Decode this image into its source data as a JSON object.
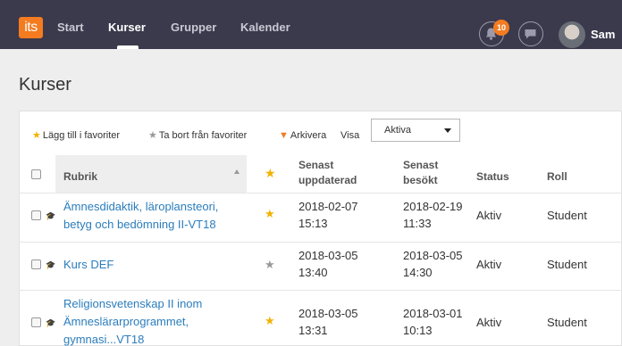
{
  "nav": {
    "logo": "its",
    "items": [
      {
        "label": "Start"
      },
      {
        "label": "Kurser"
      },
      {
        "label": "Grupper"
      },
      {
        "label": "Kalender"
      }
    ],
    "notifications_count": "10",
    "user_name": "Sam"
  },
  "page": {
    "title": "Kurser"
  },
  "toolbar": {
    "add_favorite": "Lägg till i favoriter",
    "remove_favorite": "Ta bort från favoriter",
    "archive": "Arkivera",
    "show_label": "Visa",
    "filter_value": "Aktiva"
  },
  "table": {
    "headers": {
      "title": "Rubrik",
      "updated_1": "Senast",
      "updated_2": "uppdaterad",
      "visited_1": "Senast",
      "visited_2": "besökt",
      "status": "Status",
      "role": "Roll"
    },
    "rows": [
      {
        "title_1": "Ämnesdidaktik, läroplansteori,",
        "title_2": "betyg och bedömning II-VT18",
        "favorite": true,
        "updated_date": "2018-02-07",
        "updated_time": "15:13",
        "visited_date": "2018-02-19",
        "visited_time": "11:33",
        "status": "Aktiv",
        "role": "Student"
      },
      {
        "title_1": "Kurs DEF",
        "favorite": false,
        "updated_date": "2018-03-05",
        "updated_time": "13:40",
        "visited_date": "2018-03-05",
        "visited_time": "14:30",
        "status": "Aktiv",
        "role": "Student"
      },
      {
        "title_1": "Religionsvetenskap II inom",
        "title_2": "Ämneslärarprogrammet,",
        "title_3": "gymnasi...VT18",
        "favorite": true,
        "updated_date": "2018-03-05",
        "updated_time": "13:31",
        "visited_date": "2018-03-01",
        "visited_time": "10:13",
        "status": "Aktiv",
        "role": "Student"
      }
    ]
  },
  "colors": {
    "nav_bg": "#3b3a4c",
    "accent": "#f47b20",
    "link": "#2b7dbc",
    "favorite_star": "#f3b100"
  }
}
